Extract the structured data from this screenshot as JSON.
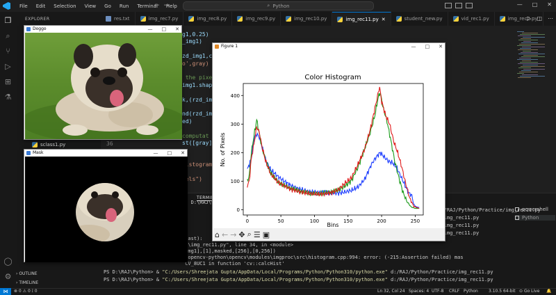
{
  "titlebar": {
    "menu": [
      "File",
      "Edit",
      "Selection",
      "View",
      "Go",
      "Run",
      "Terminal",
      "Help"
    ],
    "search": "Python",
    "controls": [
      "—",
      "□",
      "✕"
    ]
  },
  "sidebar": {
    "title": "EXPLORER",
    "file_item": "sclass1.py",
    "outline": "OUTLINE",
    "timeline": "TIMELINE"
  },
  "tabs": [
    {
      "label": "res.txt",
      "icon": "txt"
    },
    {
      "label": "img_rec7.py",
      "icon": "py"
    },
    {
      "label": "img_rec8.py",
      "icon": "py"
    },
    {
      "label": "img_rec9.py",
      "icon": "py"
    },
    {
      "label": "img_rec10.py",
      "icon": "py"
    },
    {
      "label": "img_rec11.py",
      "icon": "py",
      "active": true
    },
    {
      "label": "student_new.py",
      "icon": "py"
    },
    {
      "label": "vid_rec1.py",
      "icon": "py"
    },
    {
      "label": "img_rec2.py",
      "icon": "py"
    }
  ],
  "editor": {
    "lines": [
      "g1,0.25)",
      "_img1)",
      "",
      "zd_img1,cv",
      "o',gray)",
      "",
      " the pixe",
      "img1.shap",
      "",
      "k,(rzd_im",
      "",
      "nd(rzd_im",
      "ed)",
      "",
      "computat",
      "st([gray]",
      "",
      "",
      "Histogram",
      "",
      "xels\")"
    ],
    "line_number": "36"
  },
  "terminal": {
    "tabs": "TERMINAL",
    "lines": [
      {
        "pre": "PS D:\\RAJ\\Python> & ",
        "q": "\"C:/Users/Shreejata Gupta/AppData/Local/Programs/Python/Python310/python.exe\"",
        "post": " d:/RAJ/Python/Practice/img_rec11.py"
      },
      {
        "pre": "",
        "q": "",
        "post": "ce/img_rec11.py"
      },
      {
        "pre": "",
        "q": "",
        "post": "ce/img_rec11.py"
      },
      {
        "pre": "",
        "q": "",
        "post": "ce/img_rec11.py"
      }
    ],
    "trace": [
      " last):",
      "ce\\img_rec11.py\", line 34, in <module>",
      "_img1],[1],masked,[256],[0,256])",
      "a\\opencv-python\\opencv\\modules\\imgproc\\src\\histogram.cpp:994: error: (-215:Assertion failed) mas",
      " CV_8UC1 in function 'cv::calcHist'"
    ],
    "prompt1": {
      "pre": "PS D:\\RAJ\\Python> & ",
      "q": "\"C:/Users/Shreejata Gupta/AppData/Local/Programs/Python/Python310/python.exe\"",
      "post": " d:/RAJ/Python/Practice/img_rec11.py"
    },
    "prompt2": {
      "pre": "PS D:\\RAJ\\Python> & ",
      "q": "\"C:/Users/Shreejata Gupta/AppData/Local/Programs/Python/Python310/python.exe\"",
      "post": " d:/RAJ/Python/Practice/img_rec11.py"
    },
    "sessions": [
      "powershell",
      "Python"
    ]
  },
  "statusbar": {
    "left": "⊗ 0  ⚠ 0  ⟟ 0",
    "position": "Ln 32, Col 24",
    "spaces": "Spaces: 4",
    "encoding": "UTF-8",
    "eol": "CRLF",
    "lang": "Python",
    "interpreter": "3.10.5 64-bit",
    "golive": "Go Live"
  },
  "doggo_window": {
    "title": "Doggo"
  },
  "mask_window": {
    "title": "Mask"
  },
  "figure_window": {
    "title": "Figure 1"
  },
  "chart_data": {
    "type": "line",
    "title": "Color Histogram",
    "xlabel": "Bins",
    "ylabel": "No. of Pixels",
    "xlim": [
      0,
      256
    ],
    "ylim": [
      0,
      430
    ],
    "xticks": [
      0,
      50,
      100,
      150,
      200,
      250
    ],
    "yticks": [
      0,
      100,
      200,
      300,
      400
    ],
    "series": [
      {
        "color": "#1f3fff",
        "points": [
          [
            0,
            140
          ],
          [
            3,
            160
          ],
          [
            6,
            180
          ],
          [
            10,
            250
          ],
          [
            14,
            265
          ],
          [
            18,
            255
          ],
          [
            22,
            220
          ],
          [
            28,
            170
          ],
          [
            35,
            140
          ],
          [
            45,
            118
          ],
          [
            55,
            100
          ],
          [
            65,
            85
          ],
          [
            75,
            75
          ],
          [
            85,
            68
          ],
          [
            95,
            62
          ],
          [
            105,
            60
          ],
          [
            115,
            62
          ],
          [
            125,
            60
          ],
          [
            135,
            58
          ],
          [
            145,
            62
          ],
          [
            155,
            68
          ],
          [
            165,
            80
          ],
          [
            175,
            108
          ],
          [
            185,
            160
          ],
          [
            192,
            185
          ],
          [
            198,
            200
          ],
          [
            204,
            185
          ],
          [
            210,
            170
          ],
          [
            216,
            165
          ],
          [
            222,
            150
          ],
          [
            228,
            120
          ],
          [
            234,
            90
          ],
          [
            240,
            60
          ],
          [
            245,
            50
          ],
          [
            248,
            18
          ],
          [
            252,
            10
          ],
          [
            256,
            8
          ]
        ]
      },
      {
        "color": "#1a9a1a",
        "points": [
          [
            0,
            100
          ],
          [
            3,
            120
          ],
          [
            6,
            200
          ],
          [
            10,
            260
          ],
          [
            14,
            315
          ],
          [
            18,
            265
          ],
          [
            22,
            215
          ],
          [
            28,
            170
          ],
          [
            35,
            130
          ],
          [
            45,
            100
          ],
          [
            55,
            85
          ],
          [
            65,
            75
          ],
          [
            75,
            68
          ],
          [
            85,
            62
          ],
          [
            95,
            58
          ],
          [
            105,
            57
          ],
          [
            115,
            60
          ],
          [
            125,
            62
          ],
          [
            135,
            68
          ],
          [
            145,
            82
          ],
          [
            155,
            102
          ],
          [
            165,
            150
          ],
          [
            175,
            215
          ],
          [
            183,
            270
          ],
          [
            190,
            330
          ],
          [
            195,
            395
          ],
          [
            198,
            410
          ],
          [
            202,
            360
          ],
          [
            208,
            310
          ],
          [
            214,
            240
          ],
          [
            220,
            165
          ],
          [
            226,
            110
          ],
          [
            232,
            60
          ],
          [
            238,
            28
          ],
          [
            244,
            10
          ],
          [
            250,
            5
          ],
          [
            256,
            5
          ]
        ]
      },
      {
        "color": "#e01b1b",
        "points": [
          [
            0,
            85
          ],
          [
            3,
            100
          ],
          [
            6,
            180
          ],
          [
            10,
            230
          ],
          [
            14,
            290
          ],
          [
            18,
            270
          ],
          [
            22,
            220
          ],
          [
            28,
            165
          ],
          [
            35,
            125
          ],
          [
            45,
            98
          ],
          [
            55,
            85
          ],
          [
            65,
            72
          ],
          [
            75,
            65
          ],
          [
            85,
            60
          ],
          [
            95,
            56
          ],
          [
            105,
            55
          ],
          [
            115,
            56
          ],
          [
            125,
            60
          ],
          [
            135,
            70
          ],
          [
            145,
            92
          ],
          [
            155,
            112
          ],
          [
            165,
            160
          ],
          [
            175,
            215
          ],
          [
            183,
            280
          ],
          [
            190,
            355
          ],
          [
            195,
            410
          ],
          [
            197,
            430
          ],
          [
            200,
            380
          ],
          [
            206,
            330
          ],
          [
            212,
            300
          ],
          [
            218,
            240
          ],
          [
            224,
            200
          ],
          [
            230,
            150
          ],
          [
            236,
            90
          ],
          [
            242,
            40
          ],
          [
            248,
            12
          ],
          [
            256,
            5
          ]
        ]
      }
    ]
  }
}
